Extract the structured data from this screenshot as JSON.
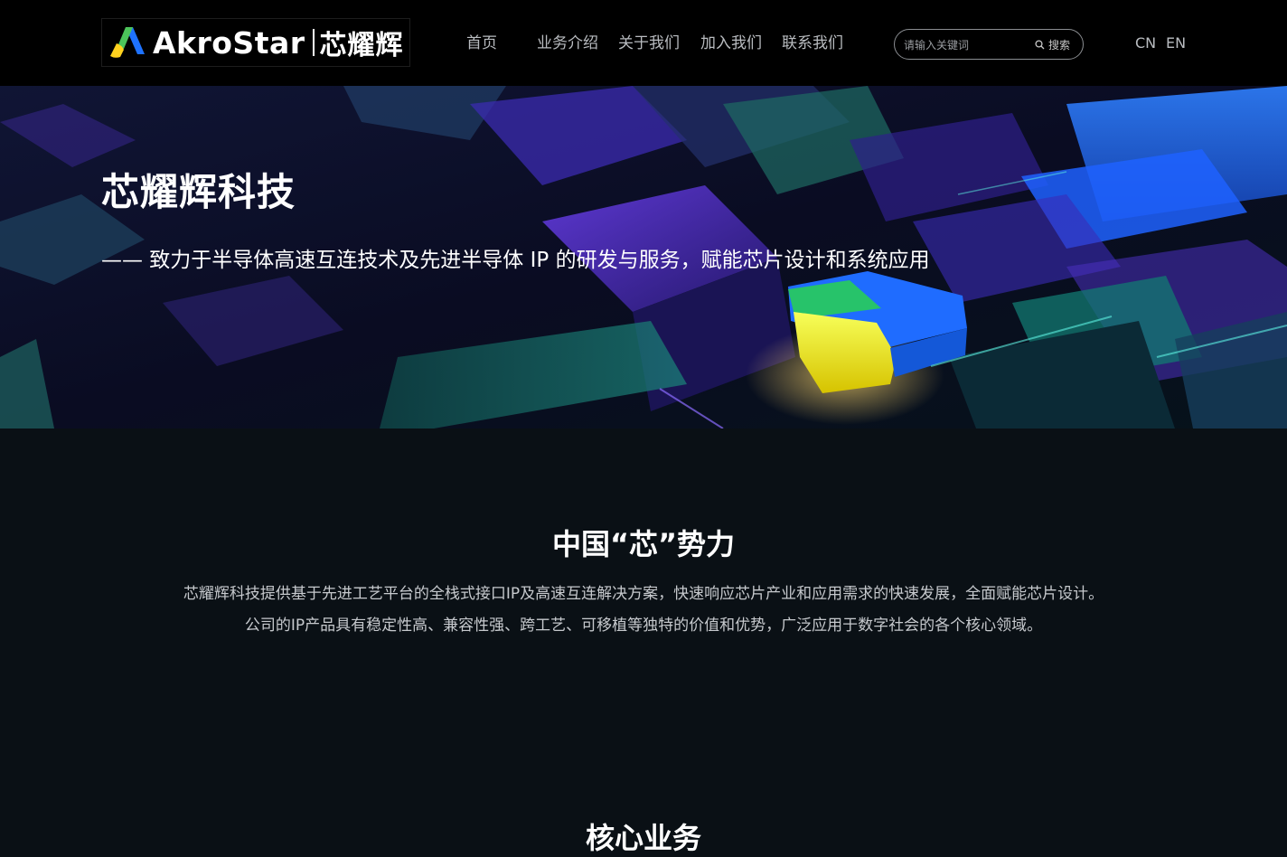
{
  "header": {
    "logo_en": "AkroStar",
    "logo_cn": "芯耀辉",
    "nav": [
      {
        "label": "首页"
      },
      {
        "label": "业务介绍"
      },
      {
        "label": "关于我们"
      },
      {
        "label": "加入我们"
      },
      {
        "label": "联系我们"
      }
    ],
    "search": {
      "placeholder": "请输入关键词",
      "button": "搜索"
    },
    "languages": [
      "CN",
      "EN"
    ]
  },
  "hero": {
    "title": "芯耀辉科技",
    "subtitle": "—— 致力于半导体高速互连技术及先进半导体 IP 的研发与服务，赋能芯片设计和系统应用"
  },
  "intro": {
    "title": "中国“芯”势力",
    "lines": [
      "芯耀辉科技提供基于先进工艺平台的全栈式接口IP及高速互连解决方案，快速响应芯片产业和应用需求的快速发展，全面赋能芯片设计。",
      "公司的IP产品具有稳定性高、兼容性强、跨工艺、可移植等独特的价值和优势，广泛应用于数字社会的各个核心领域。"
    ]
  },
  "core": {
    "title": "核心业务"
  }
}
